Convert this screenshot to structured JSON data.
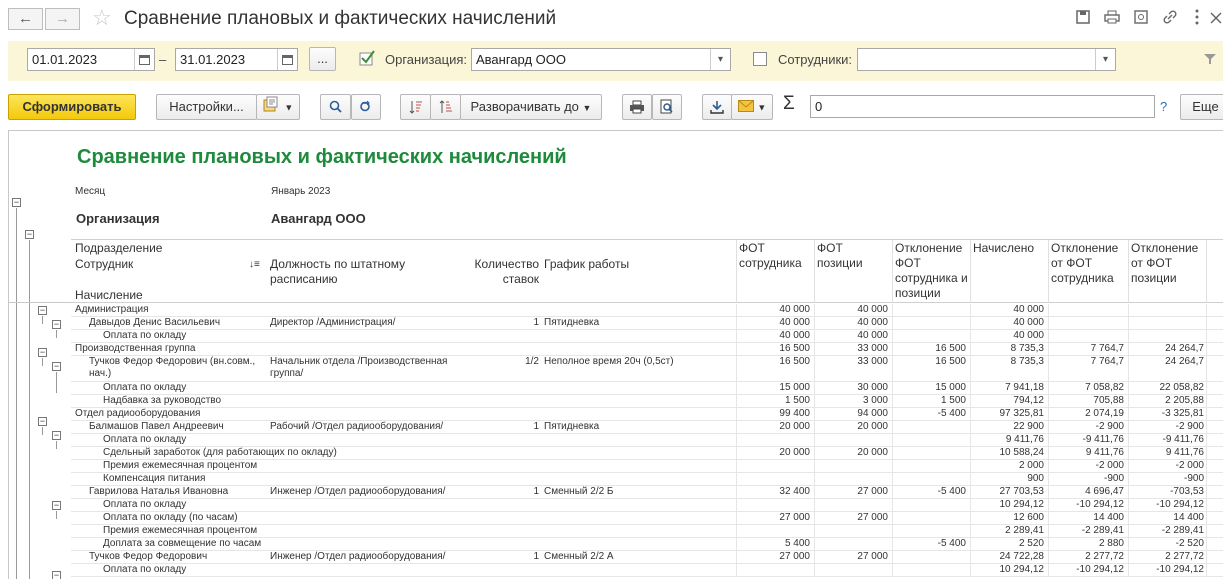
{
  "window": {
    "title": "Сравнение плановых и фактических начислений",
    "back_glyph": "←",
    "forward_glyph": "→",
    "star_glyph": "☆"
  },
  "filters": {
    "date_from": "01.01.2023",
    "date_dash": "–",
    "date_to": "31.01.2023",
    "period_button": "...",
    "org_label": "Организация:",
    "org_checked": true,
    "org_value": "Авангард ООО",
    "emp_label": "Сотрудники:",
    "emp_checked": false,
    "emp_value": ""
  },
  "toolbar": {
    "generate_label": "Сформировать",
    "settings_label": "Настройки...",
    "expand_label": "Разворачивать до",
    "sum_value": "0",
    "help_label": "?",
    "more_label": "Еще"
  },
  "report": {
    "title": "Сравнение плановых и фактических начислений",
    "month_label": "Месяц",
    "month_value": "Январь 2023",
    "org_label": "Организация",
    "org_value": "Авангард ООО",
    "headers": {
      "division": "Подразделение",
      "employee": "Сотрудник",
      "accrual": "Начисление",
      "position": "Должность по штатному расписанию",
      "rates": "Количество ставок",
      "schedule": "График работы",
      "fot_emp": "ФОТ сотрудника",
      "fot_pos": "ФОТ позиции",
      "dev_emp_pos": "Отклонение ФОТ сотрудника и позиции",
      "accrued": "Начислено",
      "dev_from_emp": "Отклонение от ФОТ сотрудника",
      "dev_from_pos": "Отклонение от ФОТ позиции"
    },
    "rows": [
      {
        "level": 0,
        "name": "Администрация",
        "position": "",
        "rates": "",
        "schedule": "",
        "fot_emp": "40 000",
        "fot_pos": "40 000",
        "dev": "",
        "accrued": "40 000",
        "dev_emp": "",
        "dev_pos": ""
      },
      {
        "level": 1,
        "name": "Давыдов Денис Васильевич",
        "position": "Директор /Администрация/",
        "rates": "1",
        "schedule": "Пятидневка",
        "fot_emp": "40 000",
        "fot_pos": "40 000",
        "dev": "",
        "accrued": "40 000",
        "dev_emp": "",
        "dev_pos": ""
      },
      {
        "level": 2,
        "name": "Оплата по окладу",
        "position": "",
        "rates": "",
        "schedule": "",
        "fot_emp": "40 000",
        "fot_pos": "40 000",
        "dev": "",
        "accrued": "40 000",
        "dev_emp": "",
        "dev_pos": ""
      },
      {
        "level": 0,
        "name": "Производственная группа",
        "position": "",
        "rates": "",
        "schedule": "",
        "fot_emp": "16 500",
        "fot_pos": "33 000",
        "dev": "16 500",
        "accrued": "8 735,3",
        "dev_emp": "7 764,7",
        "dev_pos": "24 264,7"
      },
      {
        "level": 1,
        "tall": true,
        "name": "Тучков Федор Федорович (вн.совм., нач.)",
        "position": "Начальник отдела /Производственная группа/",
        "rates": "1/2",
        "schedule": "Неполное время 20ч (0,5ст)",
        "fot_emp": "16 500",
        "fot_pos": "33 000",
        "dev": "16 500",
        "accrued": "8 735,3",
        "dev_emp": "7 764,7",
        "dev_pos": "24 264,7"
      },
      {
        "level": 2,
        "name": "Оплата по окладу",
        "position": "",
        "rates": "",
        "schedule": "",
        "fot_emp": "15 000",
        "fot_pos": "30 000",
        "dev": "15 000",
        "accrued": "7 941,18",
        "dev_emp": "7 058,82",
        "dev_pos": "22 058,82"
      },
      {
        "level": 2,
        "name": "Надбавка за руководство",
        "position": "",
        "rates": "",
        "schedule": "",
        "fot_emp": "1 500",
        "fot_pos": "3 000",
        "dev": "1 500",
        "accrued": "794,12",
        "dev_emp": "705,88",
        "dev_pos": "2 205,88"
      },
      {
        "level": 0,
        "name": "Отдел радиооборудования",
        "position": "",
        "rates": "",
        "schedule": "",
        "fot_emp": "99 400",
        "fot_pos": "94 000",
        "dev": "-5 400",
        "accrued": "97 325,81",
        "dev_emp": "2 074,19",
        "dev_pos": "-3 325,81"
      },
      {
        "level": 1,
        "name": "Балмашов Павел Андреевич",
        "position": "Рабочий /Отдел радиооборудования/",
        "rates": "1",
        "schedule": "Пятидневка",
        "fot_emp": "20 000",
        "fot_pos": "20 000",
        "dev": "",
        "accrued": "22 900",
        "dev_emp": "-2 900",
        "dev_pos": "-2 900"
      },
      {
        "level": 2,
        "name": "Оплата по окладу",
        "position": "",
        "rates": "",
        "schedule": "",
        "fot_emp": "",
        "fot_pos": "",
        "dev": "",
        "accrued": "9 411,76",
        "dev_emp": "-9 411,76",
        "dev_pos": "-9 411,76"
      },
      {
        "level": 2,
        "name": "Сдельный заработок (для работающих по окладу)",
        "position": "",
        "rates": "",
        "schedule": "",
        "fot_emp": "20 000",
        "fot_pos": "20 000",
        "dev": "",
        "accrued": "10 588,24",
        "dev_emp": "9 411,76",
        "dev_pos": "9 411,76"
      },
      {
        "level": 2,
        "name": "Премия ежемесячная процентом",
        "position": "",
        "rates": "",
        "schedule": "",
        "fot_emp": "",
        "fot_pos": "",
        "dev": "",
        "accrued": "2 000",
        "dev_emp": "-2 000",
        "dev_pos": "-2 000"
      },
      {
        "level": 2,
        "name": "Компенсация питания",
        "position": "",
        "rates": "",
        "schedule": "",
        "fot_emp": "",
        "fot_pos": "",
        "dev": "",
        "accrued": "900",
        "dev_emp": "-900",
        "dev_pos": "-900"
      },
      {
        "level": 1,
        "name": "Гаврилова Наталья Ивановна",
        "position": "Инженер /Отдел радиооборудования/",
        "rates": "1",
        "schedule": "Сменный 2/2 Б",
        "fot_emp": "32 400",
        "fot_pos": "27 000",
        "dev": "-5 400",
        "accrued": "27 703,53",
        "dev_emp": "4 696,47",
        "dev_pos": "-703,53"
      },
      {
        "level": 2,
        "name": "Оплата по окладу",
        "position": "",
        "rates": "",
        "schedule": "",
        "fot_emp": "",
        "fot_pos": "",
        "dev": "",
        "accrued": "10 294,12",
        "dev_emp": "-10 294,12",
        "dev_pos": "-10 294,12"
      },
      {
        "level": 2,
        "name": "Оплата по окладу (по часам)",
        "position": "",
        "rates": "",
        "schedule": "",
        "fot_emp": "27 000",
        "fot_pos": "27 000",
        "dev": "",
        "accrued": "12 600",
        "dev_emp": "14 400",
        "dev_pos": "14 400"
      },
      {
        "level": 2,
        "name": "Премия ежемесячная процентом",
        "position": "",
        "rates": "",
        "schedule": "",
        "fot_emp": "",
        "fot_pos": "",
        "dev": "",
        "accrued": "2 289,41",
        "dev_emp": "-2 289,41",
        "dev_pos": "-2 289,41"
      },
      {
        "level": 2,
        "name": "Доплата за совмещение по часам",
        "position": "",
        "rates": "",
        "schedule": "",
        "fot_emp": "5 400",
        "fot_pos": "",
        "dev": "-5 400",
        "accrued": "2 520",
        "dev_emp": "2 880",
        "dev_pos": "-2 520"
      },
      {
        "level": 1,
        "name": "Тучков Федор Федорович",
        "position": "Инженер /Отдел радиооборудования/",
        "rates": "1",
        "schedule": "Сменный 2/2 А",
        "fot_emp": "27 000",
        "fot_pos": "27 000",
        "dev": "",
        "accrued": "24 722,28",
        "dev_emp": "2 277,72",
        "dev_pos": "2 277,72"
      },
      {
        "level": 2,
        "name": "Оплата по окладу",
        "position": "",
        "rates": "",
        "schedule": "",
        "fot_emp": "",
        "fot_pos": "",
        "dev": "",
        "accrued": "10 294,12",
        "dev_emp": "-10 294,12",
        "dev_pos": "-10 294,12"
      }
    ]
  }
}
